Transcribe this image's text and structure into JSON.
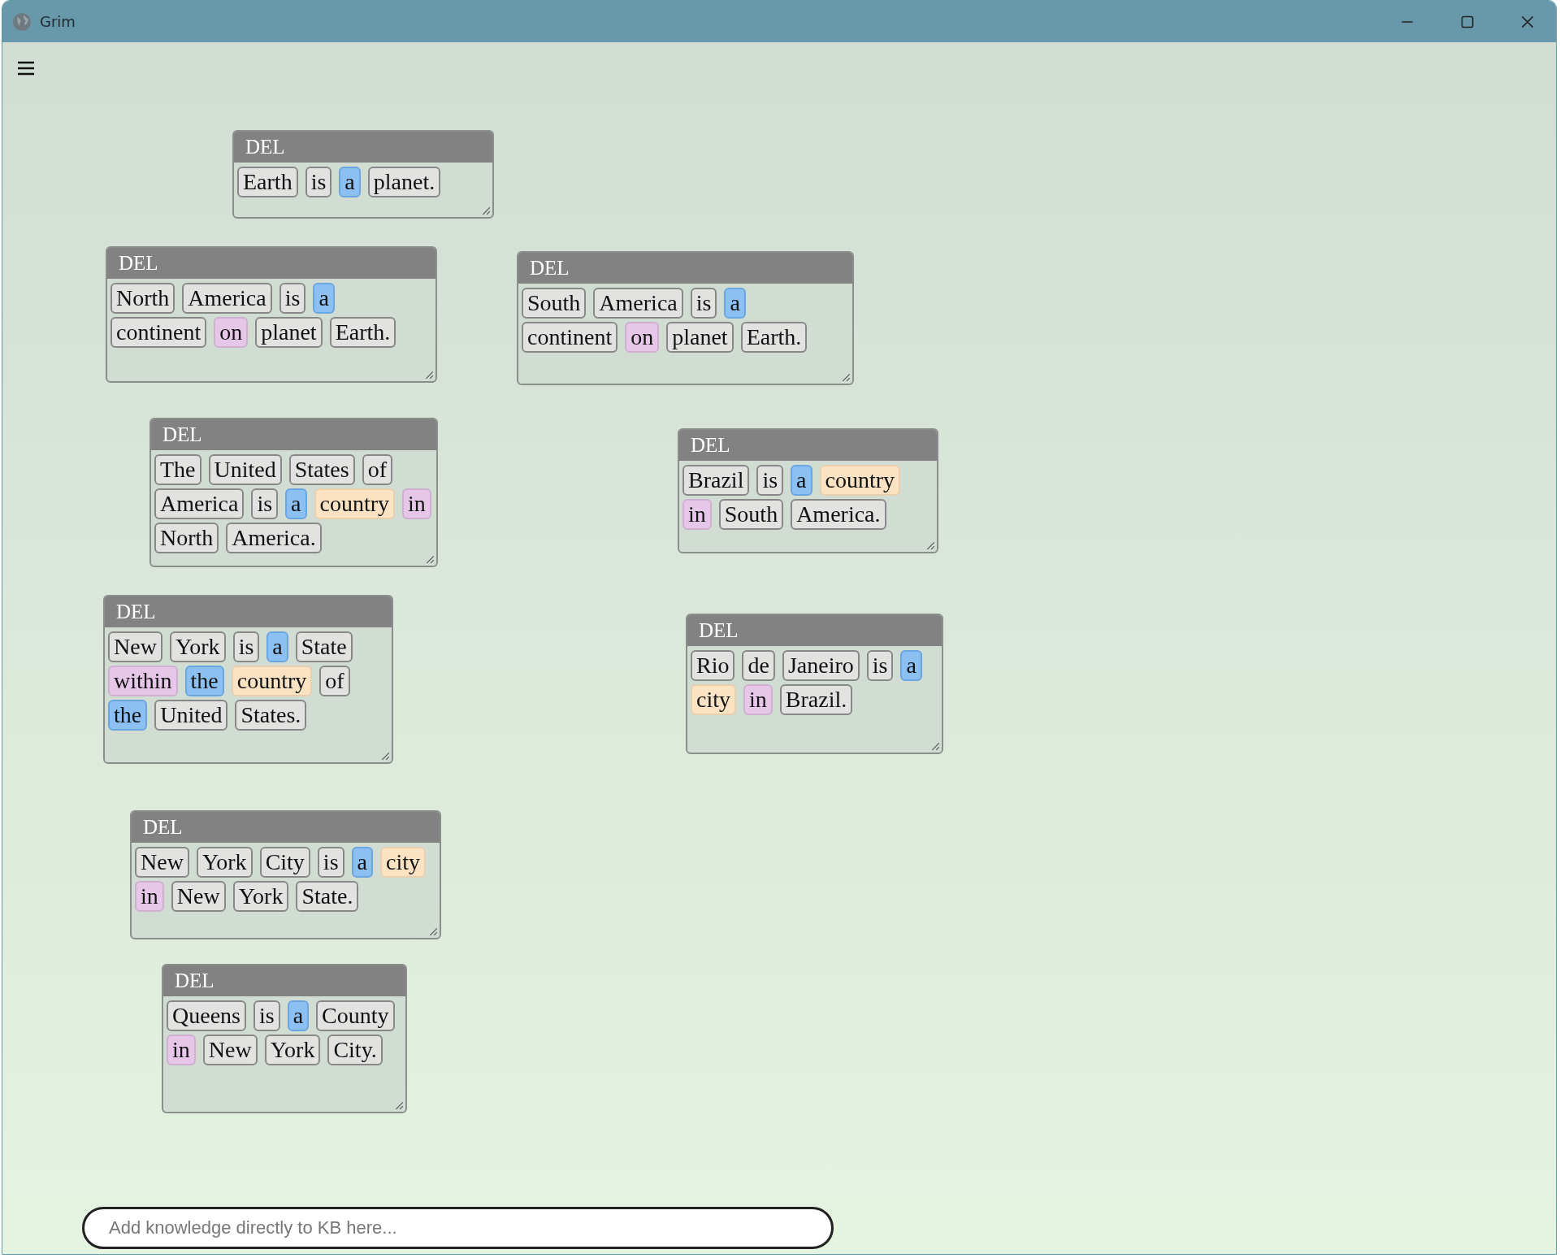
{
  "window": {
    "title": "Grim"
  },
  "cards": [
    {
      "header": "DEL",
      "words": [
        {
          "text": "Earth",
          "kind": "plain"
        },
        {
          "text": "is",
          "kind": "plain"
        },
        {
          "text": "a",
          "kind": "determiner"
        },
        {
          "text": "planet.",
          "kind": "plain"
        }
      ]
    },
    {
      "header": "DEL",
      "words": [
        {
          "text": "North",
          "kind": "plain"
        },
        {
          "text": "America",
          "kind": "plain"
        },
        {
          "text": "is",
          "kind": "plain"
        },
        {
          "text": "a",
          "kind": "determiner"
        },
        {
          "text": "continent",
          "kind": "plain"
        },
        {
          "text": "on",
          "kind": "relation"
        },
        {
          "text": "planet",
          "kind": "plain"
        },
        {
          "text": "Earth.",
          "kind": "plain"
        }
      ]
    },
    {
      "header": "DEL",
      "words": [
        {
          "text": "South",
          "kind": "plain"
        },
        {
          "text": "America",
          "kind": "plain"
        },
        {
          "text": "is",
          "kind": "plain"
        },
        {
          "text": "a",
          "kind": "determiner"
        },
        {
          "text": "continent",
          "kind": "plain"
        },
        {
          "text": "on",
          "kind": "relation"
        },
        {
          "text": "planet",
          "kind": "plain"
        },
        {
          "text": "Earth.",
          "kind": "plain"
        }
      ]
    },
    {
      "header": "DEL",
      "words": [
        {
          "text": "The",
          "kind": "plain"
        },
        {
          "text": "United",
          "kind": "plain"
        },
        {
          "text": "States",
          "kind": "plain"
        },
        {
          "text": "of",
          "kind": "plain"
        },
        {
          "text": "America",
          "kind": "plain"
        },
        {
          "text": "is",
          "kind": "plain"
        },
        {
          "text": "a",
          "kind": "determiner"
        },
        {
          "text": "country",
          "kind": "category"
        },
        {
          "text": "in",
          "kind": "relation"
        },
        {
          "text": "North",
          "kind": "plain"
        },
        {
          "text": "America.",
          "kind": "plain"
        }
      ]
    },
    {
      "header": "DEL",
      "words": [
        {
          "text": "Brazil",
          "kind": "plain"
        },
        {
          "text": "is",
          "kind": "plain"
        },
        {
          "text": "a",
          "kind": "determiner"
        },
        {
          "text": "country",
          "kind": "category"
        },
        {
          "text": "in",
          "kind": "relation"
        },
        {
          "text": "South",
          "kind": "plain"
        },
        {
          "text": "America.",
          "kind": "plain"
        }
      ]
    },
    {
      "header": "DEL",
      "words": [
        {
          "text": "New",
          "kind": "plain"
        },
        {
          "text": "York",
          "kind": "plain"
        },
        {
          "text": "is",
          "kind": "plain"
        },
        {
          "text": "a",
          "kind": "determiner"
        },
        {
          "text": "State",
          "kind": "plain"
        },
        {
          "text": "within",
          "kind": "relation"
        },
        {
          "text": "the",
          "kind": "determiner"
        },
        {
          "text": "country",
          "kind": "category"
        },
        {
          "text": "of",
          "kind": "plain"
        },
        {
          "text": "the",
          "kind": "determiner"
        },
        {
          "text": "United",
          "kind": "plain"
        },
        {
          "text": "States.",
          "kind": "plain"
        }
      ]
    },
    {
      "header": "DEL",
      "words": [
        {
          "text": "Rio",
          "kind": "plain"
        },
        {
          "text": "de",
          "kind": "plain"
        },
        {
          "text": "Janeiro",
          "kind": "plain"
        },
        {
          "text": "is",
          "kind": "plain"
        },
        {
          "text": "a",
          "kind": "determiner"
        },
        {
          "text": "city",
          "kind": "category"
        },
        {
          "text": "in",
          "kind": "relation"
        },
        {
          "text": "Brazil.",
          "kind": "plain"
        }
      ]
    },
    {
      "header": "DEL",
      "words": [
        {
          "text": "New",
          "kind": "plain"
        },
        {
          "text": "York",
          "kind": "plain"
        },
        {
          "text": "City",
          "kind": "plain"
        },
        {
          "text": "is",
          "kind": "plain"
        },
        {
          "text": "a",
          "kind": "determiner"
        },
        {
          "text": "city",
          "kind": "category"
        },
        {
          "text": "in",
          "kind": "relation"
        },
        {
          "text": "New",
          "kind": "plain"
        },
        {
          "text": "York",
          "kind": "plain"
        },
        {
          "text": "State.",
          "kind": "plain"
        }
      ]
    },
    {
      "header": "DEL",
      "words": [
        {
          "text": "Queens",
          "kind": "plain"
        },
        {
          "text": "is",
          "kind": "plain"
        },
        {
          "text": "a",
          "kind": "determiner"
        },
        {
          "text": "County",
          "kind": "plain"
        },
        {
          "text": "in",
          "kind": "relation"
        },
        {
          "text": "New",
          "kind": "plain"
        },
        {
          "text": "York",
          "kind": "plain"
        },
        {
          "text": "City.",
          "kind": "plain"
        }
      ]
    }
  ],
  "input": {
    "placeholder": "Add knowledge directly to KB here..."
  }
}
